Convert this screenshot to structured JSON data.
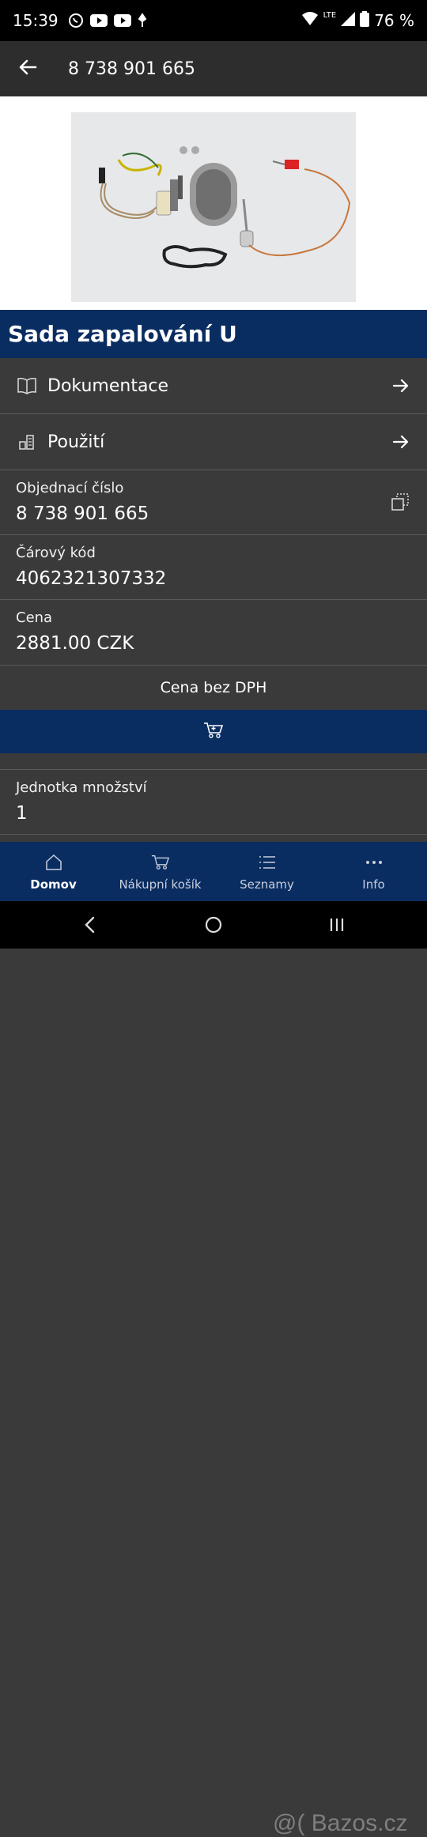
{
  "status_bar": {
    "time": "15:39",
    "network": "LTE",
    "battery": "76 %"
  },
  "app_bar": {
    "back_icon": "arrow-left-icon",
    "title": "8 738 901 665"
  },
  "product": {
    "image_alt": "",
    "title": "Sada zapalování U"
  },
  "nav_rows": [
    {
      "icon": "book-icon",
      "label": "Dokumentace"
    },
    {
      "icon": "usage-icon",
      "label": "Použití"
    }
  ],
  "info": {
    "order_number": {
      "label": "Objednací číslo",
      "value": "8 738 901 665"
    },
    "barcode": {
      "label": "Čárový kód",
      "value": "4062321307332"
    },
    "price": {
      "label": "Cena",
      "value": "2881.00 CZK"
    },
    "price_note": "Cena bez DPH",
    "unit": {
      "label": "Jednotka množství",
      "value": "1"
    }
  },
  "bottom_nav": [
    {
      "icon": "home-icon",
      "label": "Domov",
      "active": true
    },
    {
      "icon": "cart-icon",
      "label": "Nákupní košík",
      "active": false
    },
    {
      "icon": "list-icon",
      "label": "Seznamy",
      "active": false
    },
    {
      "icon": "more-icon",
      "label": "Info",
      "active": false
    }
  ],
  "watermark": "@( Bazos.cz",
  "colors": {
    "brand_blue": "#0a2d61",
    "row_bg": "#3a3a3a"
  }
}
